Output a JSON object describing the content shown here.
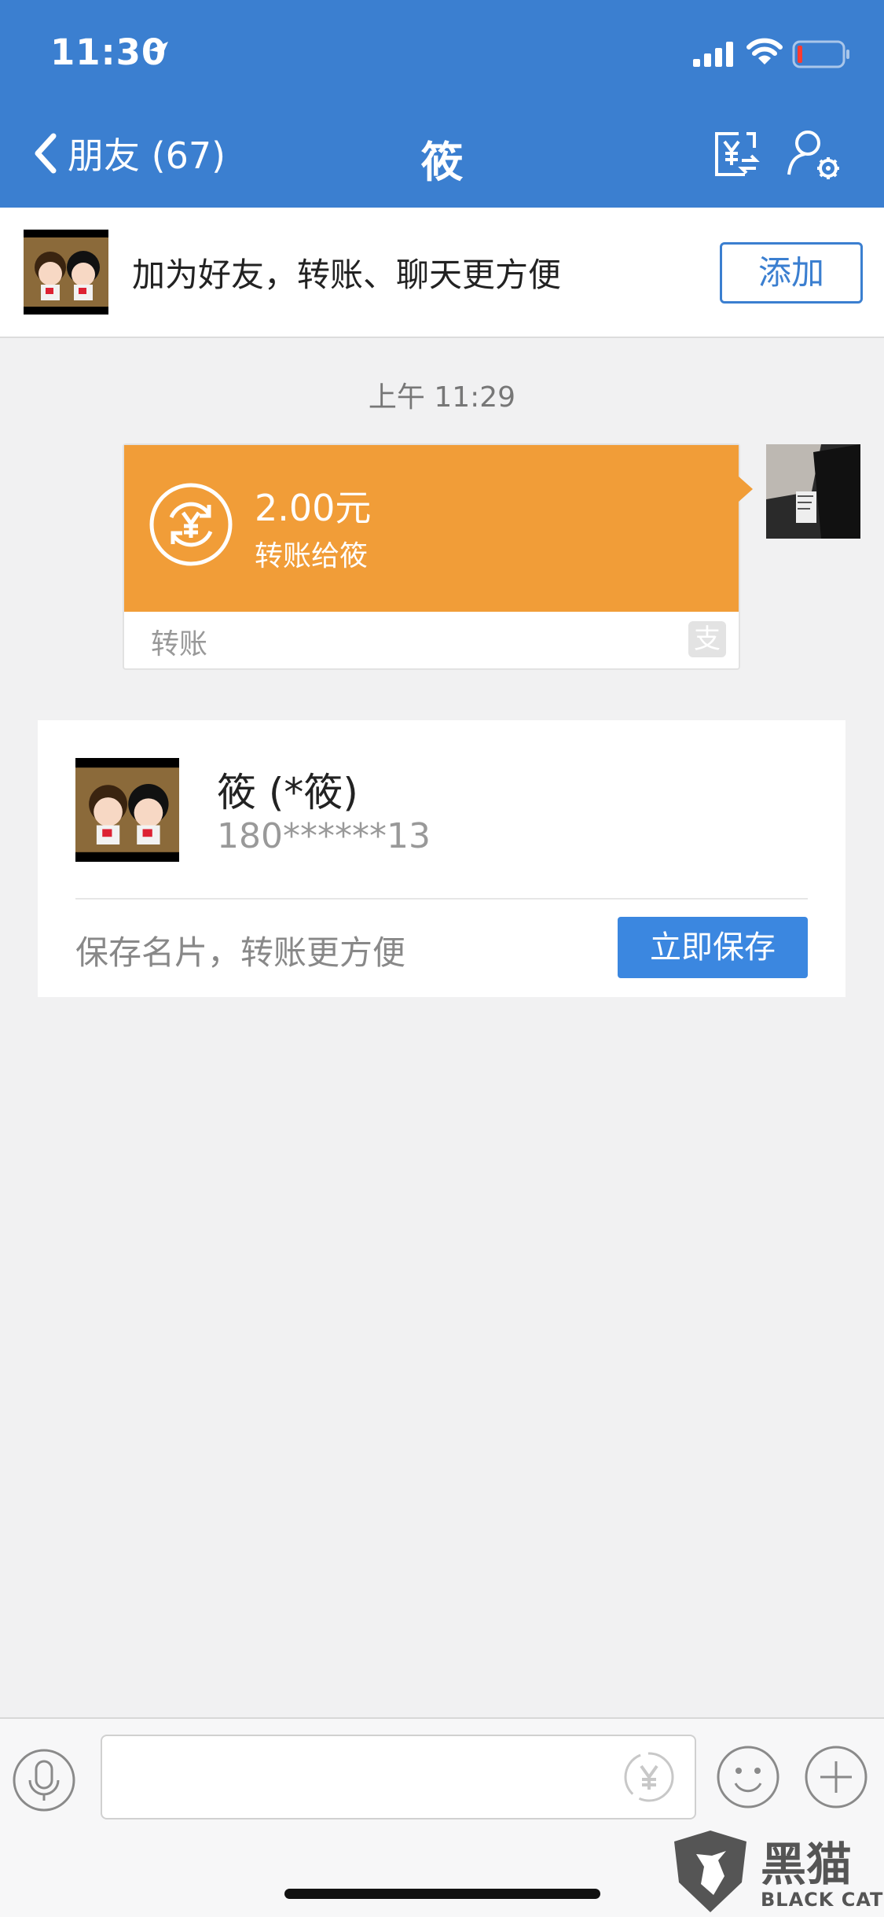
{
  "status_bar": {
    "time": "11:30"
  },
  "nav": {
    "back_label": "朋友 (67)",
    "title": "筱"
  },
  "friend_banner": {
    "text": "加为好友，转账、聊天更方便",
    "add_label": "添加"
  },
  "chat": {
    "timestamp": "上午 11:29",
    "transfer": {
      "amount": "2.00元",
      "recipient_text": "转账给筱",
      "footer_label": "转账",
      "alipay_glyph": "支",
      "color": "#f19d38"
    }
  },
  "contact_card": {
    "name": "筱 (*筱)",
    "phone": "180******13",
    "save_hint": "保存名片，转账更方便",
    "save_label": "立即保存"
  },
  "watermark": {
    "text": "黑猫",
    "sub": "BLACK CAT"
  },
  "colors": {
    "header": "#3b7fd0",
    "accent_button": "#3b87e0",
    "background": "#f1f1f2"
  },
  "icons": [
    "location-arrow-icon",
    "signal-icon",
    "wifi-icon",
    "battery-icon",
    "back-chevron-icon",
    "transfer-yuan-icon",
    "contact-settings-icon",
    "transfer-cycle-icon",
    "alipay-icon",
    "microphone-icon",
    "yuan-icon",
    "emoji-icon",
    "plus-icon"
  ]
}
